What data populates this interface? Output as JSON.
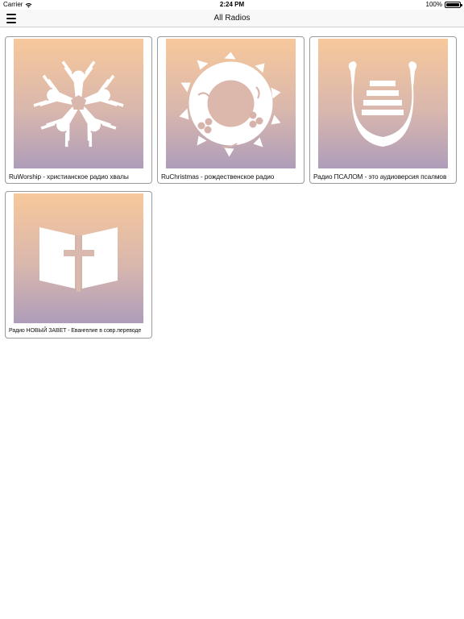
{
  "status": {
    "carrier": "Carrier",
    "time": "2:24 PM",
    "battery_text": "100%",
    "battery_level": 1.0
  },
  "nav": {
    "title": "All Radios"
  },
  "radios": [
    {
      "label": "RuWorship - христианское радио хвалы",
      "icon": "hands-star-icon"
    },
    {
      "label": "RuChristmas - рождественское радио",
      "icon": "wreath-icon"
    },
    {
      "label": "Радио ПСАЛОМ - это аудиоверсия псалмов",
      "icon": "lyre-icon"
    },
    {
      "label": "Радио НОВЫЙ ЗАВЕТ - Евангелие в совр.переводе",
      "icon": "bible-cross-icon"
    }
  ],
  "colors": {
    "art_gradient_top": "#f7c89b",
    "art_gradient_bottom": "#ae9dba",
    "icon_fill": "#ffffff",
    "card_border": "#9a9a9a"
  }
}
